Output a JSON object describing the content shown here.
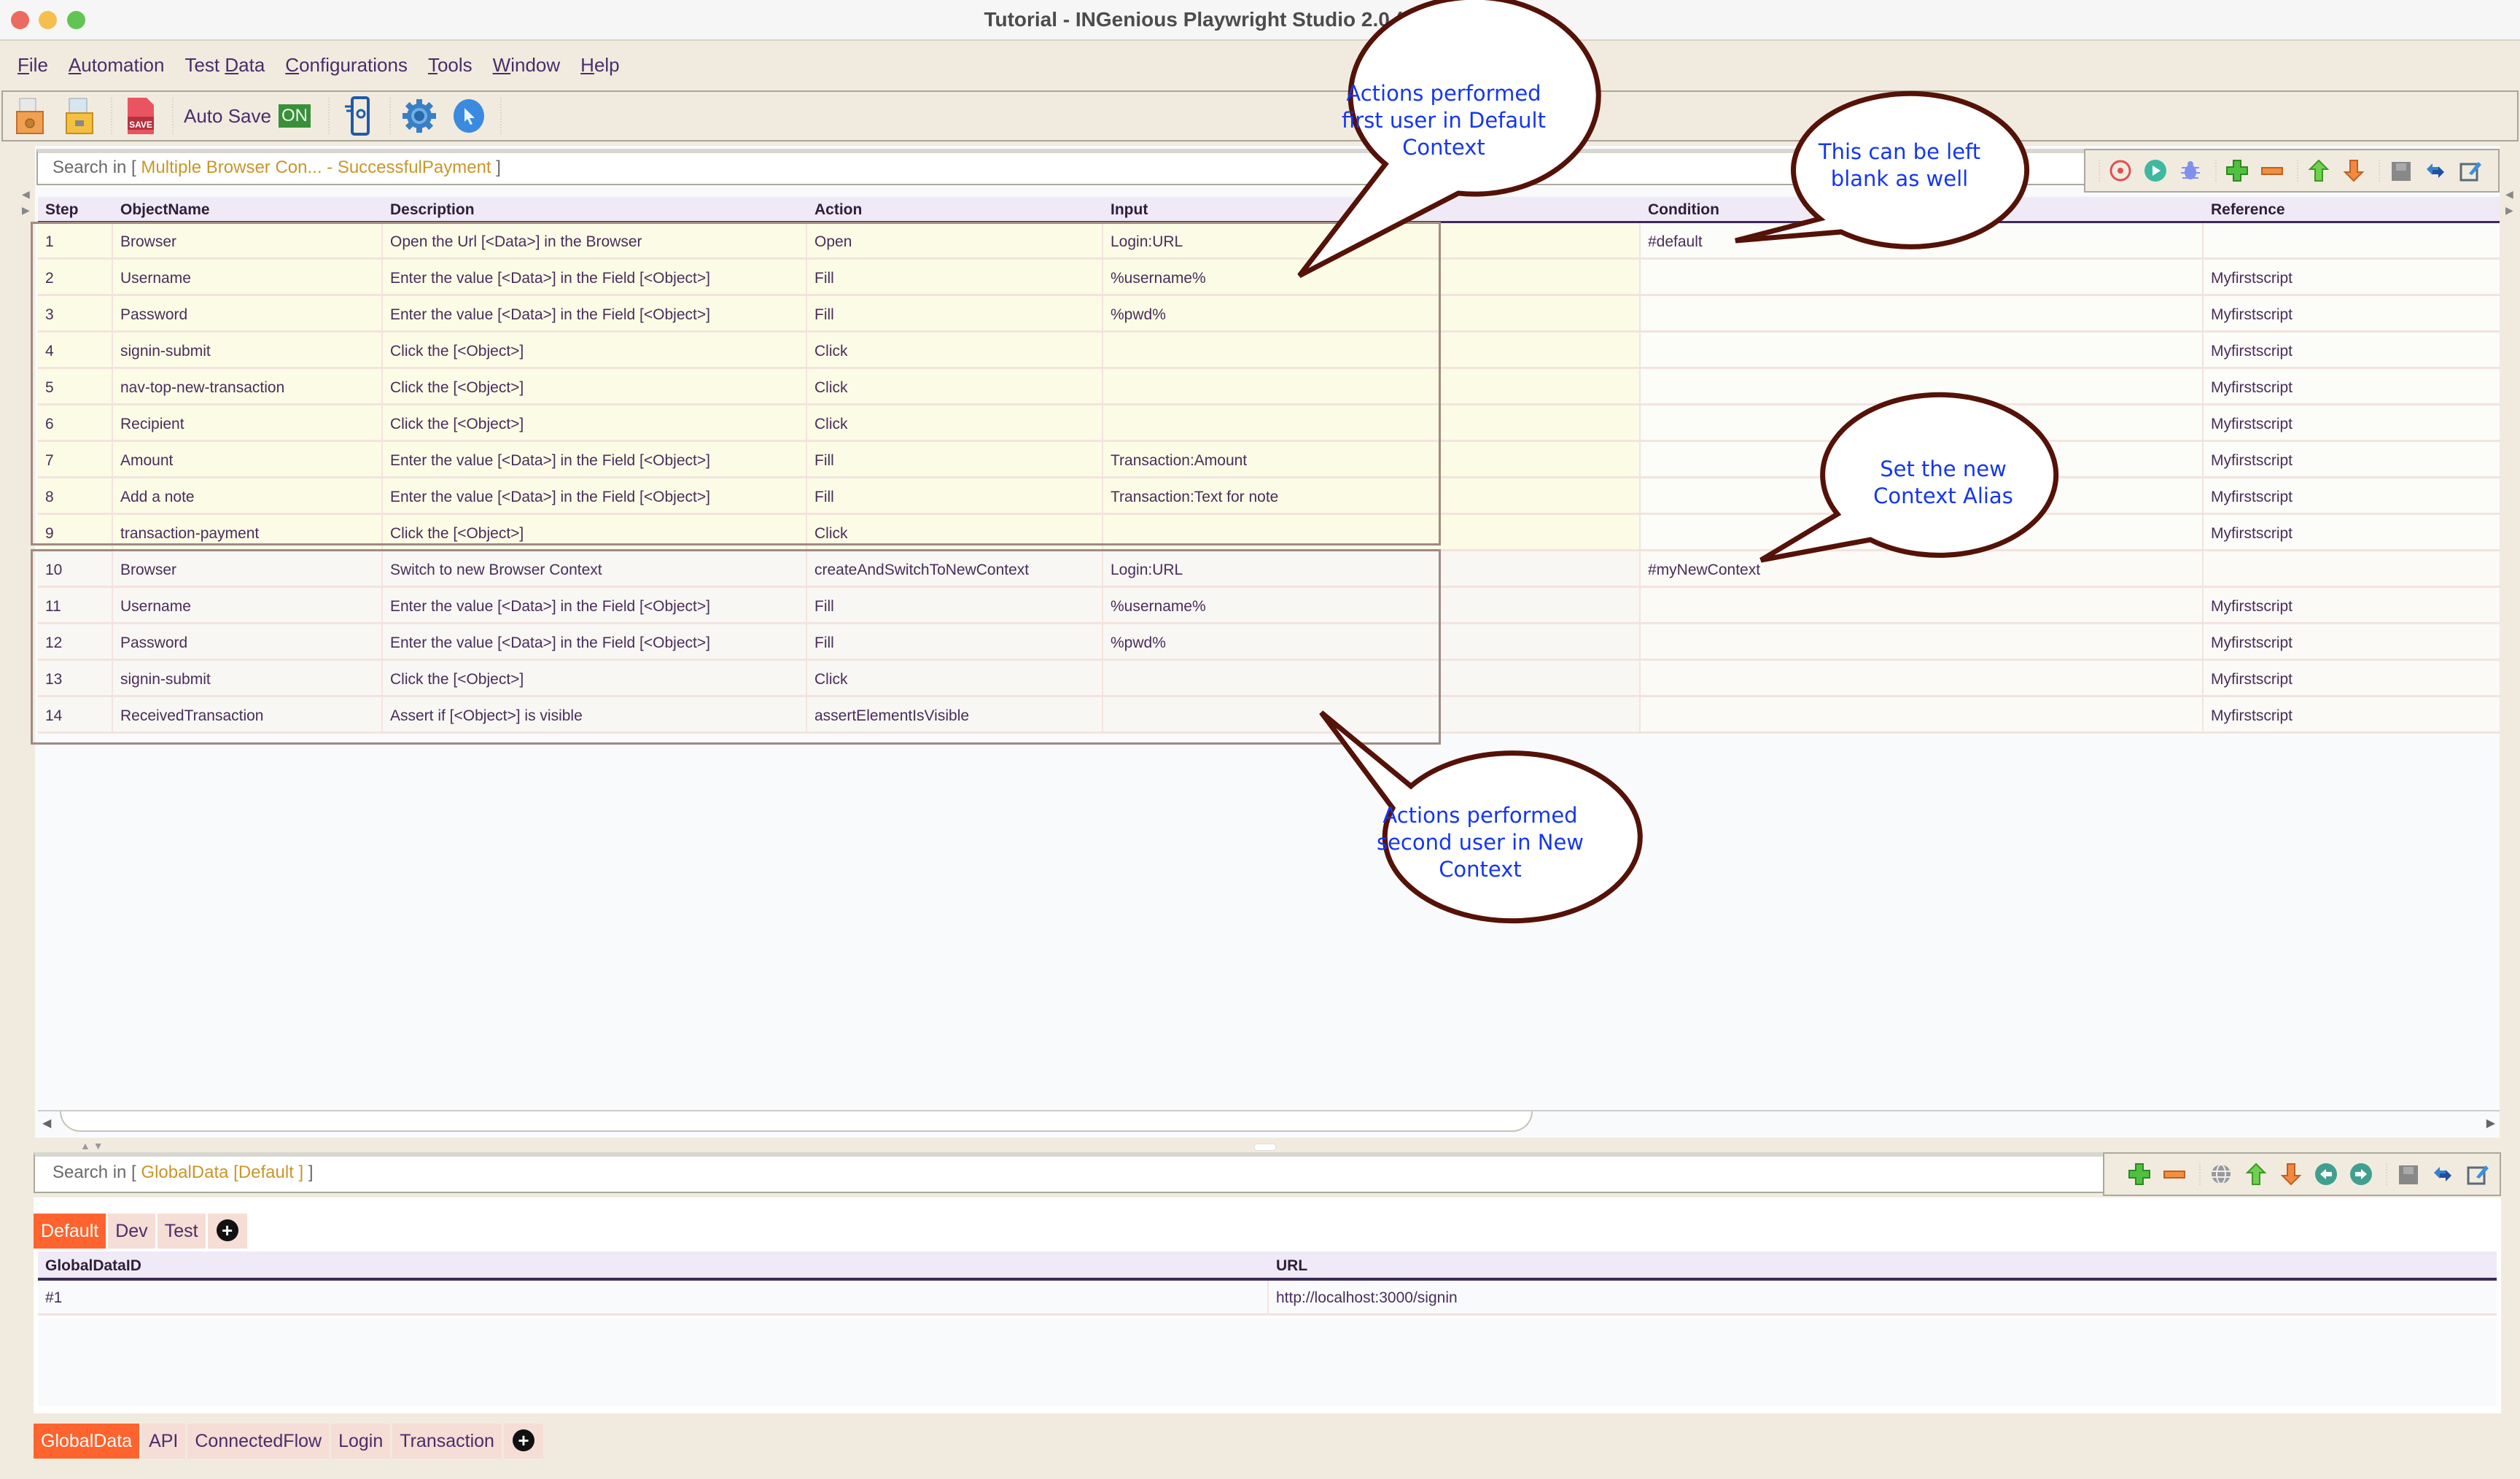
{
  "window": {
    "title": "Tutorial - INGenious Playwright Studio 2.0 (Open Source)"
  },
  "menu": [
    {
      "label_u": "F",
      "label_rest": "ile"
    },
    {
      "label_u": "A",
      "label_rest": "utomation"
    },
    {
      "label_pre": "Test ",
      "label_u": "D",
      "label_rest": "ata"
    },
    {
      "label_u": "C",
      "label_rest": "onfigurations"
    },
    {
      "label_u": "T",
      "label_rest": "ools"
    },
    {
      "label_u": "W",
      "label_rest": "indow"
    },
    {
      "label_u": "H",
      "label_rest": "elp"
    }
  ],
  "toolbar": {
    "icons": [
      "open-project-icon",
      "save-project-icon",
      "save-icon",
      "mobile-spy-icon",
      "settings-gear-icon",
      "browser-inspector-icon"
    ],
    "autosave_label": "Auto Save",
    "autosave_state": "ON"
  },
  "step_panel": {
    "search_prefix": "Search in [ ",
    "search_scope": "Multiple Browser Con... - SuccessfulPayment",
    "search_suffix": " ]",
    "tools": [
      "record-icon",
      "run-icon",
      "debug-icon",
      "add-row-icon",
      "remove-row-icon",
      "move-up-icon",
      "move-down-icon",
      "save-icon",
      "toggle-icon",
      "edit-icon"
    ],
    "columns": [
      "Step",
      "ObjectName",
      "Description",
      "Action",
      "Input",
      "Condition",
      "Reference"
    ],
    "rows": [
      {
        "step": "1",
        "object": "Browser",
        "description": "Open the Url [<Data>] in the Browser",
        "action": "Open",
        "input": "Login:URL",
        "condition": "#default",
        "reference": ""
      },
      {
        "step": "2",
        "object": "Username",
        "description": "Enter the value [<Data>] in the Field [<Object>]",
        "action": "Fill",
        "input": "%username%",
        "condition": "",
        "reference": "Myfirstscript"
      },
      {
        "step": "3",
        "object": "Password",
        "description": "Enter the value [<Data>] in the Field [<Object>]",
        "action": "Fill",
        "input": "%pwd%",
        "condition": "",
        "reference": "Myfirstscript"
      },
      {
        "step": "4",
        "object": "signin-submit",
        "description": "Click the [<Object>]",
        "action": "Click",
        "input": "",
        "condition": "",
        "reference": "Myfirstscript"
      },
      {
        "step": "5",
        "object": "nav-top-new-transaction",
        "description": "Click the [<Object>]",
        "action": "Click",
        "input": "",
        "condition": "",
        "reference": "Myfirstscript"
      },
      {
        "step": "6",
        "object": "Recipient",
        "description": "Click the [<Object>]",
        "action": "Click",
        "input": "",
        "condition": "",
        "reference": "Myfirstscript"
      },
      {
        "step": "7",
        "object": "Amount",
        "description": "Enter the value [<Data>] in the Field [<Object>]",
        "action": "Fill",
        "input": "Transaction:Amount",
        "condition": "",
        "reference": "Myfirstscript"
      },
      {
        "step": "8",
        "object": "Add a note",
        "description": "Enter the value [<Data>] in the Field [<Object>]",
        "action": "Fill",
        "input": "Transaction:Text for note",
        "condition": "",
        "reference": "Myfirstscript"
      },
      {
        "step": "9",
        "object": "transaction-payment",
        "description": "Click the [<Object>]",
        "action": "Click",
        "input": "",
        "condition": "",
        "reference": "Myfirstscript"
      },
      {
        "step": "10",
        "object": "Browser",
        "description": "Switch to new Browser Context",
        "action": "createAndSwitchToNewContext",
        "input": "Login:URL",
        "condition": "#myNewContext",
        "reference": ""
      },
      {
        "step": "11",
        "object": "Username",
        "description": "Enter the value [<Data>] in the Field [<Object>]",
        "action": "Fill",
        "input": "%username%",
        "condition": "",
        "reference": "Myfirstscript"
      },
      {
        "step": "12",
        "object": "Password",
        "description": "Enter the value [<Data>] in the Field [<Object>]",
        "action": "Fill",
        "input": "%pwd%",
        "condition": "",
        "reference": "Myfirstscript"
      },
      {
        "step": "13",
        "object": "signin-submit",
        "description": "Click the [<Object>]",
        "action": "Click",
        "input": "",
        "condition": "",
        "reference": "Myfirstscript"
      },
      {
        "step": "14",
        "object": "ReceivedTransaction",
        "description": "Assert if [<Object>] is visible",
        "action": "assertElementIsVisible",
        "input": "",
        "condition": "",
        "reference": "Myfirstscript"
      }
    ]
  },
  "global_data_panel": {
    "search_prefix": "Search in [ ",
    "search_scope": "GlobalData [Default ]",
    "search_suffix": " ]",
    "tools": [
      "add-row-icon",
      "remove-row-icon",
      "globe-icon",
      "move-up-icon",
      "move-down-icon",
      "previous-icon",
      "next-icon",
      "save-icon",
      "toggle-icon",
      "edit-icon"
    ],
    "env_tabs": [
      "Default",
      "Dev",
      "Test"
    ],
    "active_env_tab": "Default",
    "columns": [
      "GlobalDataID",
      "URL"
    ],
    "rows": [
      {
        "id": "#1",
        "url": "http://localhost:3000/signin"
      }
    ]
  },
  "sheet_tabs": [
    "GlobalData",
    "API",
    "ConnectedFlow",
    "Login",
    "Transaction"
  ],
  "active_sheet_tab": "GlobalData",
  "callouts": {
    "default_context": [
      "Actions performed",
      "first user in Default",
      "Context"
    ],
    "blank": [
      "This can be left",
      "blank as well"
    ],
    "new_alias": [
      "Set the new",
      "Context Alias"
    ],
    "new_context": [
      "Actions performed",
      "second user in New",
      "Context"
    ]
  },
  "colors": {
    "accent_tab": "#ff632e",
    "callout_text": "#1536f0",
    "callout_border": "#551208",
    "search_scope": "#c8962a",
    "autosave_on": "#3a8f3a"
  }
}
